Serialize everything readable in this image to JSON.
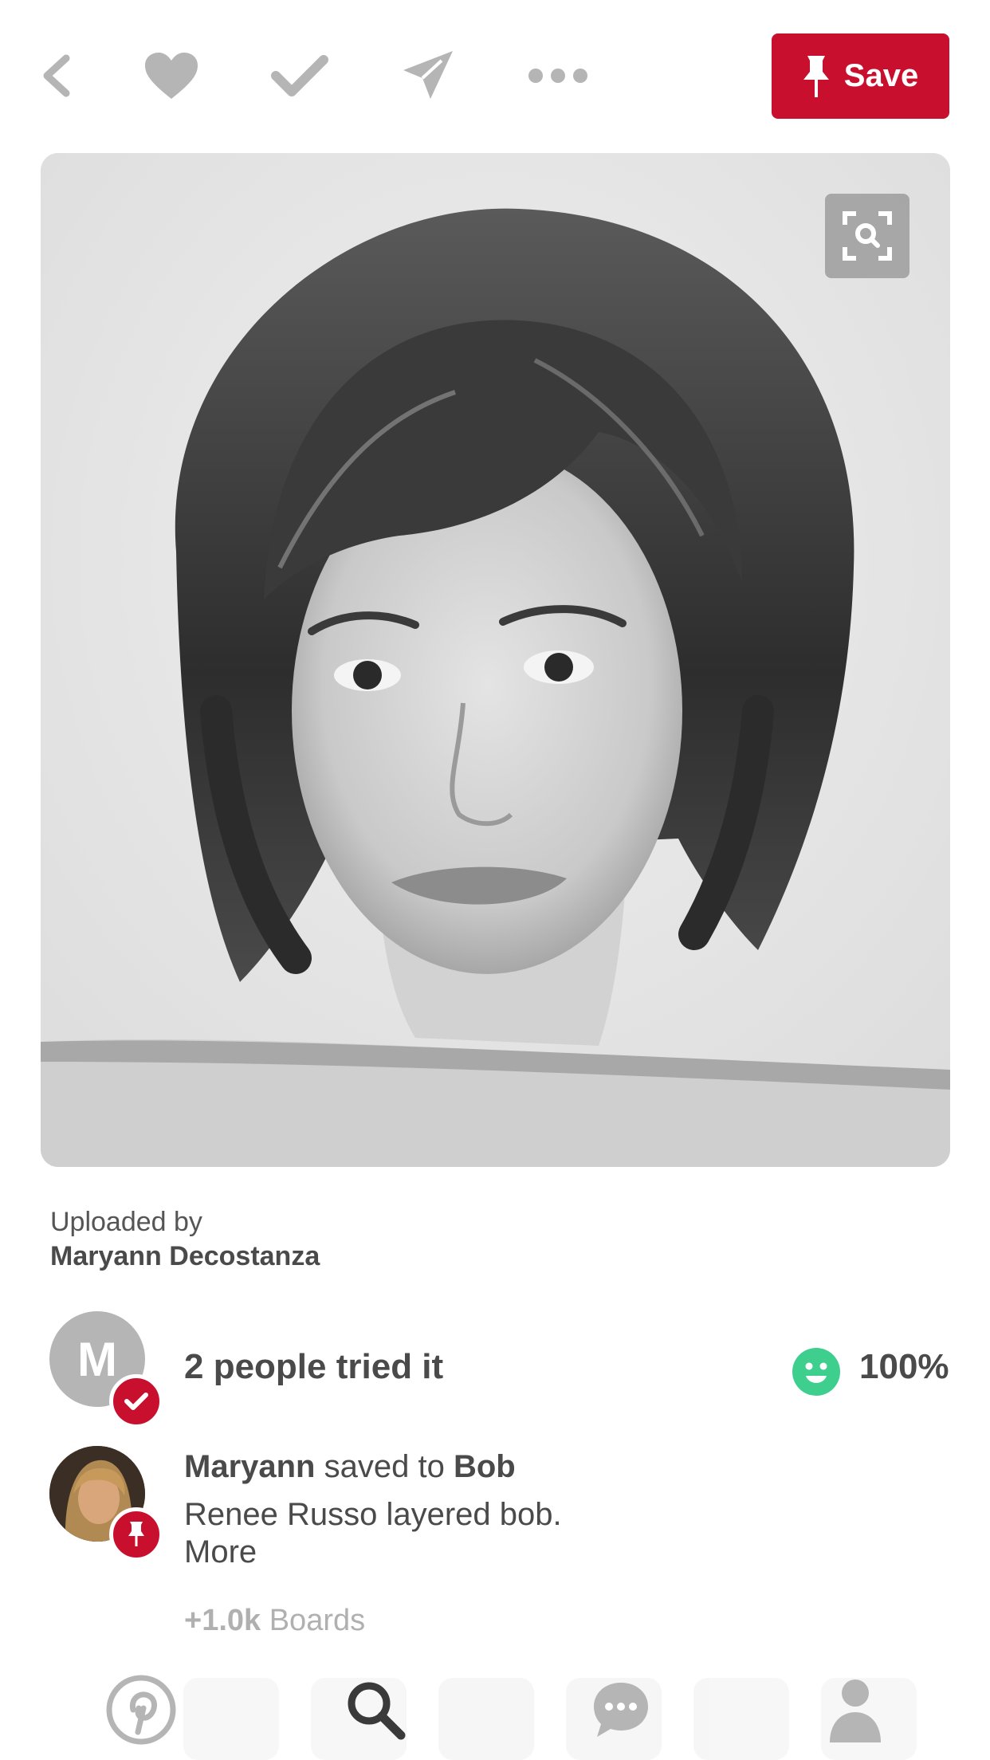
{
  "toolbar": {
    "back_icon": "chevron-left-icon",
    "like_icon": "heart-icon",
    "tried_icon": "checkmark-icon",
    "send_icon": "paper-plane-icon",
    "more_icon": "ellipsis-icon",
    "save_label": "Save",
    "save_color": "#c8102e",
    "icon_color": "#b5b5b5"
  },
  "pin": {
    "image_description": "black-and-white portrait photo",
    "lens_icon": "visual-search-icon"
  },
  "uploader": {
    "label": "Uploaded by",
    "name": "Maryann Decostanza"
  },
  "tried": {
    "avatar_initial": "M",
    "text": "2 people tried it",
    "rating_icon": "smile-icon",
    "rating_color": "#3ecf8e",
    "percent": "100%"
  },
  "saved": {
    "user": "Maryann",
    "middle": " saved to ",
    "board": "Bob",
    "description": "Renee Russo layered bob.",
    "more": "More",
    "boards_count": "+1.0k",
    "boards_label": " Boards"
  },
  "bottom_nav": {
    "items": [
      "pinterest-logo-icon",
      "search-icon",
      "messages-icon",
      "profile-icon"
    ]
  }
}
